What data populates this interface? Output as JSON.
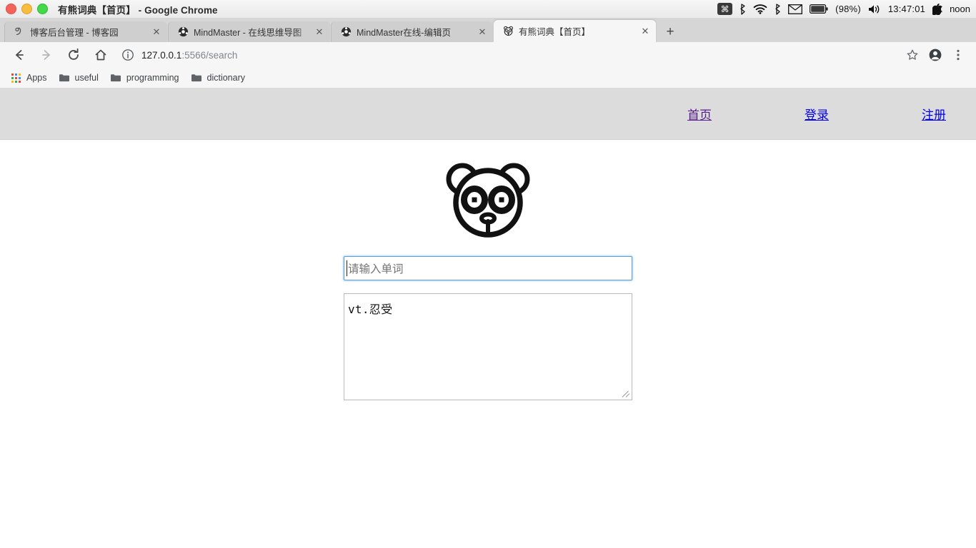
{
  "window": {
    "title": "有熊词典【首页】 - Google Chrome",
    "traffic_lights": [
      "close",
      "minimize",
      "maximize"
    ]
  },
  "menubar": {
    "command_glyph": "⌘",
    "items": [
      {
        "name": "command-indicator",
        "label": "⌘"
      },
      {
        "name": "bluetooth-icon",
        "label": ""
      },
      {
        "name": "wifi-icon",
        "label": ""
      },
      {
        "name": "bluetooth-secondary-icon",
        "label": ""
      },
      {
        "name": "mail-icon",
        "label": ""
      },
      {
        "name": "battery-icon",
        "label": ""
      }
    ],
    "battery_percent": "(98%)",
    "clock": "13:47:01",
    "user": "noon"
  },
  "tabstrip": {
    "tabs": [
      {
        "title": "博客后台管理 - 博客园",
        "favicon": "blog-favicon",
        "active": false,
        "close_label": "✕"
      },
      {
        "title": "MindMaster - 在线思维导图",
        "favicon": "mindmaster-favicon",
        "active": false,
        "close_label": "✕"
      },
      {
        "title": "MindMaster在线-编辑页",
        "favicon": "mindmaster-favicon",
        "active": false,
        "close_label": "✕"
      },
      {
        "title": "有熊词典【首页】",
        "favicon": "panda-favicon",
        "active": true,
        "close_label": "✕"
      }
    ],
    "new_tab_label": "+"
  },
  "toolbar": {
    "back_label": "←",
    "forward_label": "→",
    "reload_label": "⟳",
    "home_label": "⌂",
    "url_host": "127.0.0.1",
    "url_rest": ":5566/search",
    "bookmark_star": "star-icon",
    "profile": "profile-icon",
    "menu": "three-dot-menu-icon"
  },
  "bookmarks": [
    {
      "label": "Apps",
      "icon": "apps-grid-icon"
    },
    {
      "label": "useful",
      "icon": "folder-icon"
    },
    {
      "label": "programming",
      "icon": "folder-icon"
    },
    {
      "label": "dictionary",
      "icon": "folder-icon"
    }
  ],
  "site": {
    "nav": [
      {
        "label": "首页",
        "state": "visited"
      },
      {
        "label": "登录",
        "state": "link"
      },
      {
        "label": "注册",
        "state": "link"
      }
    ],
    "logo_name": "panda-logo",
    "search": {
      "value": "",
      "placeholder": "请输入单词"
    },
    "result": {
      "text": "vt.忍受"
    }
  },
  "colors": {
    "link": "#0000ee",
    "visited_link": "#551a8b",
    "header_band": "#dcdcdc",
    "focus_border": "#5a9fd4"
  }
}
